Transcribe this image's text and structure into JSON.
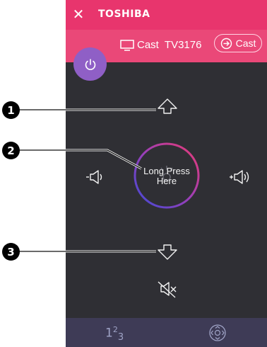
{
  "header": {
    "close_glyph": "✕",
    "brand": "TOSHIBA"
  },
  "cast_bar": {
    "device_name": "Cast  TV3176",
    "cast_button_label": "Cast"
  },
  "remote": {
    "center_label": "Long Press Here",
    "icons": [
      "power-icon",
      "channel-up-icon",
      "channel-down-icon",
      "volume-down-icon",
      "volume-up-icon",
      "mute-icon",
      "numpad-icon",
      "dpad-icon"
    ]
  },
  "bottom_bar": {
    "numpad_label_base": "1",
    "numpad_label_sup": "2",
    "numpad_label_sub": "3"
  },
  "callouts": [
    "1",
    "2",
    "3"
  ],
  "colors": {
    "header_pink": "#e8356d",
    "castbar_pink": "#ea4878",
    "body_dark": "#2f2f34",
    "power_purple": "#8f5fc6",
    "bottom_bar": "#3e3b56"
  }
}
